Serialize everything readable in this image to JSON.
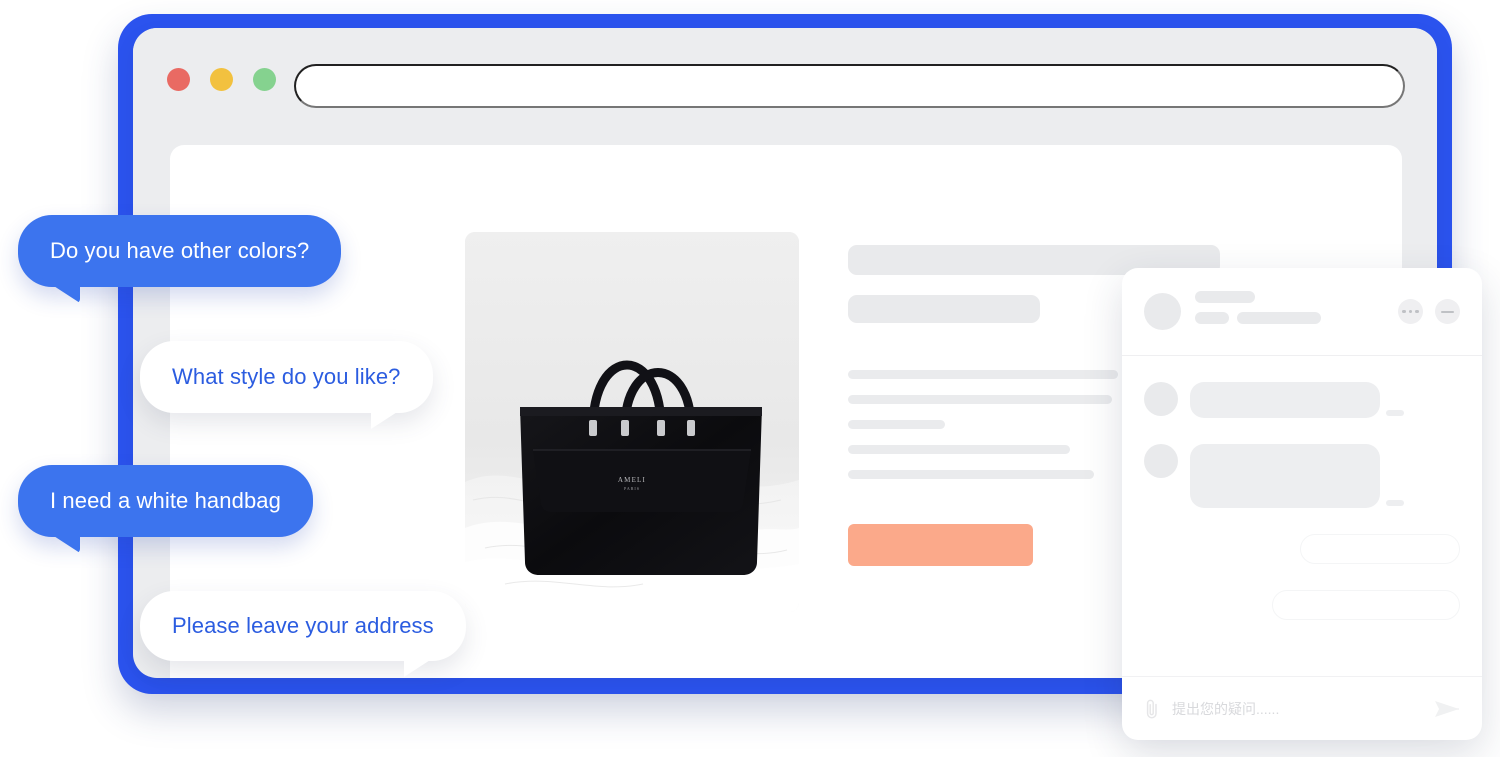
{
  "frame": {
    "accent_color": "#2B53EE",
    "name": "browser-device-frame"
  },
  "browser": {
    "traffic_lights": [
      {
        "name": "close-dot",
        "color": "#E96A63"
      },
      {
        "name": "minimize-dot",
        "color": "#F2C13F"
      },
      {
        "name": "maximize-dot",
        "color": "#85D28F"
      }
    ],
    "address_bar": {
      "value": "",
      "placeholder": ""
    }
  },
  "product": {
    "photo_alt": "black-leather-tote-handbag-on-white-bedding",
    "brand_mark": "AMELI",
    "brand_sub": "PARIS",
    "cta_color": "#FBA98A",
    "cta_label": ""
  },
  "skeleton": {
    "title_1": "",
    "title_2": "",
    "lines": [
      "",
      "",
      "",
      "",
      ""
    ]
  },
  "bubbles": [
    {
      "id": "bubble-1",
      "text": "Do you have other colors?",
      "style": "customer",
      "color": "#3C74EE"
    },
    {
      "id": "bubble-2",
      "text": "What style do you like?",
      "style": "agent",
      "color": "#FFFFFF"
    },
    {
      "id": "bubble-3",
      "text": "I need a white handbag",
      "style": "customer",
      "color": "#3C74EE"
    },
    {
      "id": "bubble-4",
      "text": "Please leave your address",
      "style": "agent",
      "color": "#FFFFFF"
    }
  ],
  "chat_widget": {
    "header": {
      "avatar": "agent-avatar",
      "title_placeholder": "",
      "subtitle_placeholder": "",
      "more_options_icon": "kebab-menu-icon",
      "minimize_icon": "minimize-icon"
    },
    "messages": [
      {
        "direction": "in",
        "avatar": "contact-avatar",
        "text": "",
        "timestamp": ""
      },
      {
        "direction": "in",
        "avatar": "contact-avatar",
        "text": "",
        "timestamp": ""
      },
      {
        "direction": "out",
        "text": ""
      },
      {
        "direction": "out",
        "text": ""
      }
    ],
    "composer": {
      "attach_icon": "paperclip-icon",
      "input_value": "",
      "input_placeholder": "提出您的疑问......",
      "send_icon": "send-icon"
    }
  }
}
